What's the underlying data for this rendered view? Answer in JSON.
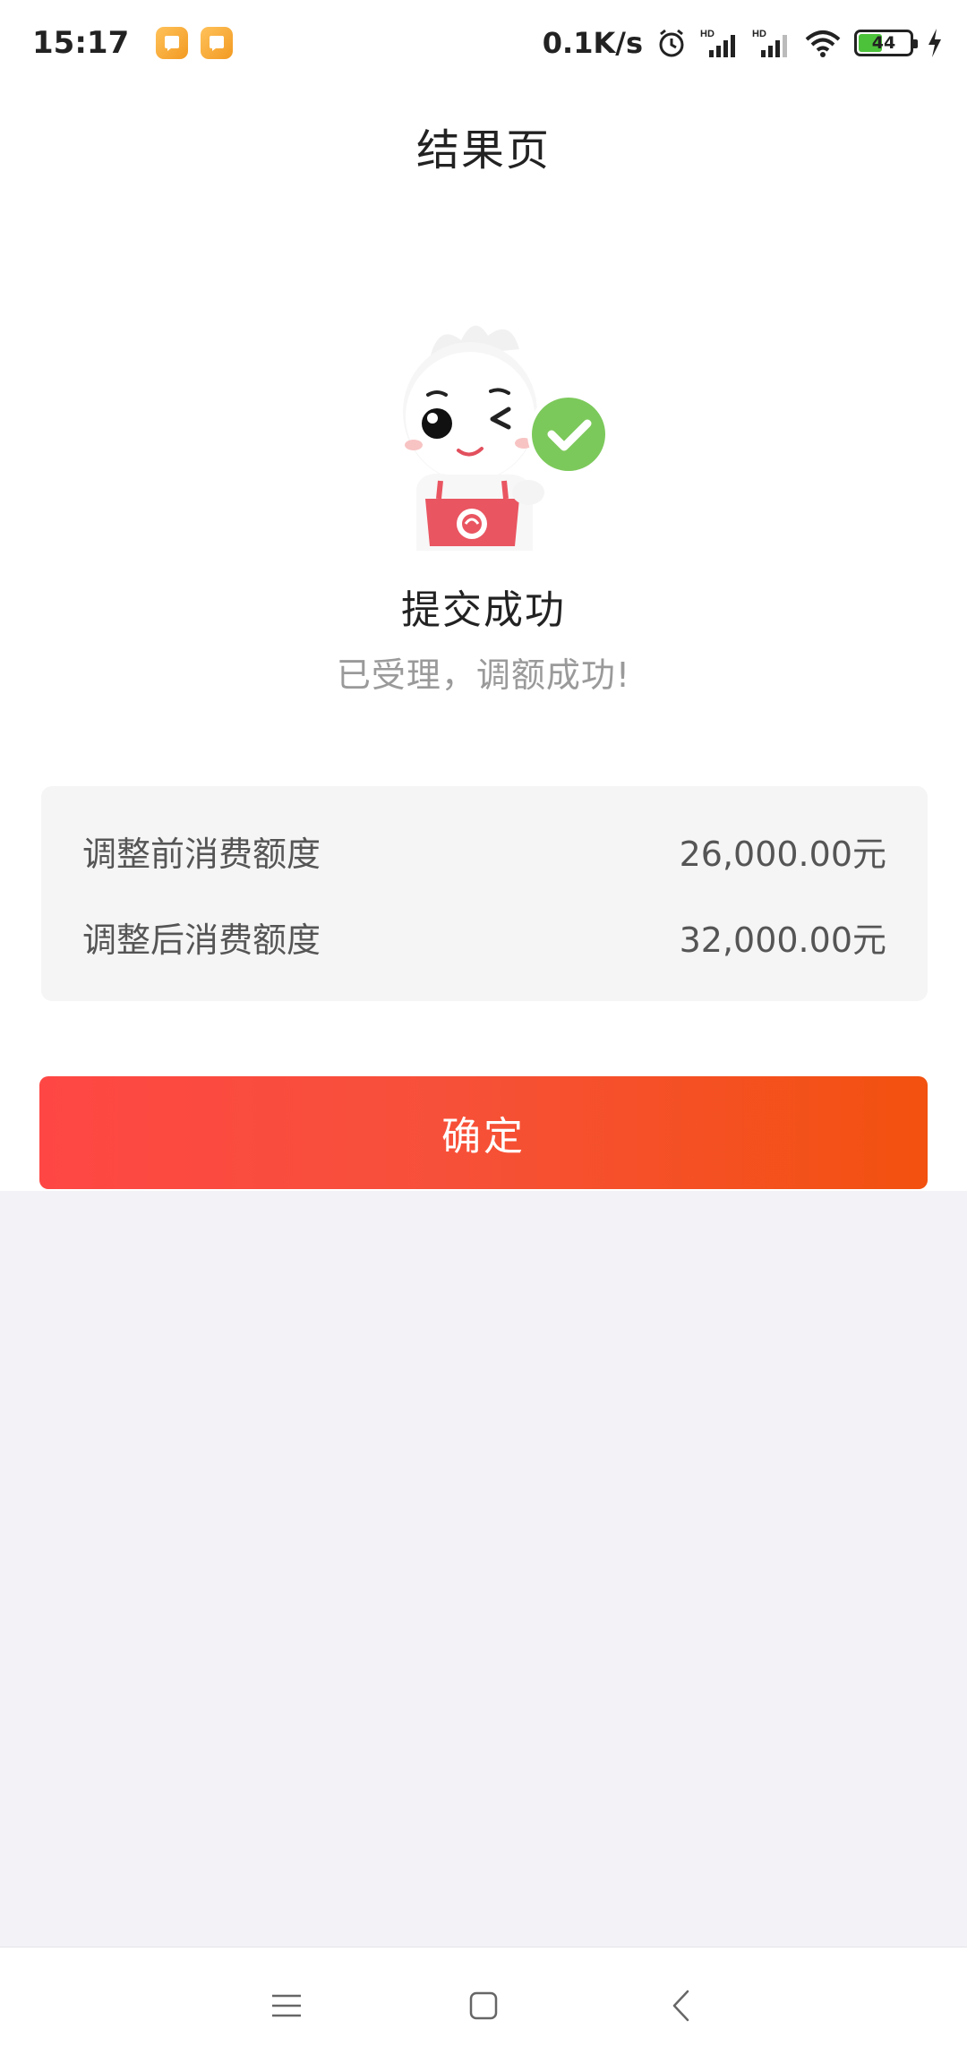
{
  "status_bar": {
    "time": "15:17",
    "network_speed": "0.1K/s",
    "battery_level": "44",
    "icons": [
      "notification-icon",
      "notification-icon",
      "alarm-icon",
      "signal-hd-icon",
      "signal-hd-icon",
      "wifi-icon",
      "battery-icon",
      "charging-icon"
    ]
  },
  "header": {
    "title": "结果页"
  },
  "result": {
    "title": "提交成功",
    "subtitle": "已受理，调额成功!",
    "status_icon": "check-circle-icon",
    "status_color": "#7cc95b"
  },
  "limits": [
    {
      "label": "调整前消费额度",
      "value": "26,000.00元"
    },
    {
      "label": "调整后消费额度",
      "value": "32,000.00元"
    }
  ],
  "actions": {
    "confirm_label": "确定",
    "accent_color": "#f7503a"
  },
  "nav_bar": {
    "items": [
      "menu-icon",
      "home-icon",
      "back-icon"
    ]
  }
}
